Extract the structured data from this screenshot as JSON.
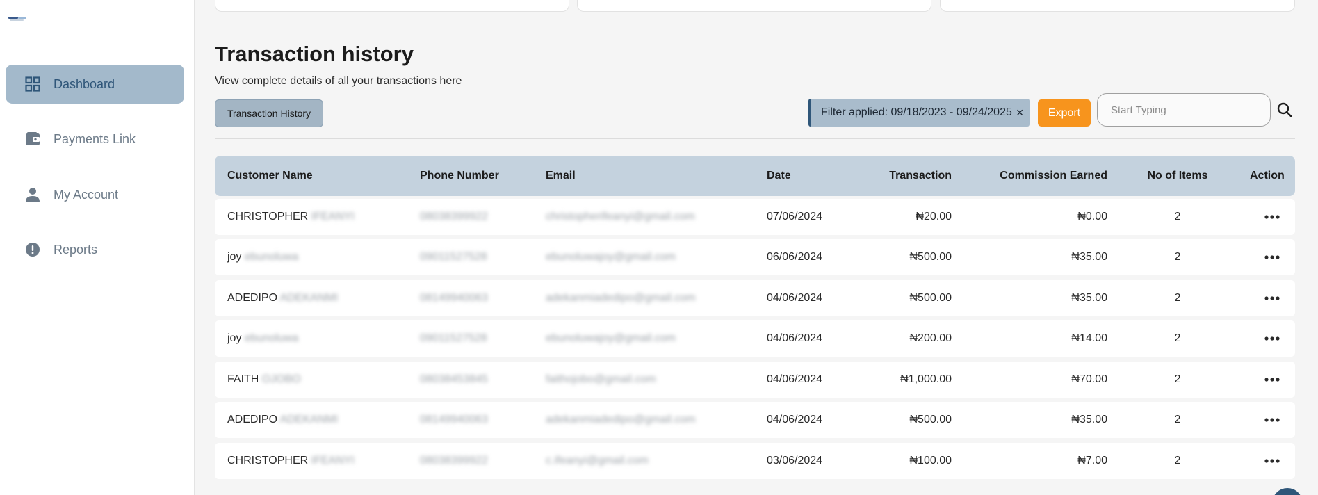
{
  "sidebar": {
    "items": [
      {
        "label": "Dashboard",
        "icon": "grid-icon",
        "active": true
      },
      {
        "label": "Payments Link",
        "icon": "wallet-icon",
        "active": false
      },
      {
        "label": "My Account",
        "icon": "user-icon",
        "active": false
      },
      {
        "label": "Reports",
        "icon": "alert-icon",
        "active": false
      }
    ]
  },
  "header": {
    "title": "Transaction history",
    "subtitle": "View complete details of all your transactions here"
  },
  "toolbar": {
    "tab_label": "Transaction History",
    "filter_label": "Filter applied: 09/18/2023 - 09/24/2025",
    "filter_close": "×",
    "export_label": "Export",
    "search_placeholder": "Start Typing"
  },
  "table": {
    "columns": [
      "Customer Name",
      "Phone Number",
      "Email",
      "Date",
      "Transaction",
      "Commission Earned",
      "No of Items",
      "Action"
    ],
    "rows": [
      {
        "first": "CHRISTOPHER",
        "last": "IFEANYI",
        "phone": "08038399922",
        "email": "christopherifeanyi@gmail.com",
        "date": "07/06/2024",
        "transaction": "₦20.00",
        "commission": "₦0.00",
        "items": "2"
      },
      {
        "first": "joy",
        "last": "ebunoluwa",
        "phone": "09011527528",
        "email": "ebunoluwajoy@gmail.com",
        "date": "06/06/2024",
        "transaction": "₦500.00",
        "commission": "₦35.00",
        "items": "2"
      },
      {
        "first": "ADEDIPO",
        "last": "ADEKANMI",
        "phone": "08149940063",
        "email": "adekanmiadedipo@gmail.com",
        "date": "04/06/2024",
        "transaction": "₦500.00",
        "commission": "₦35.00",
        "items": "2"
      },
      {
        "first": "joy",
        "last": "ebunoluwa",
        "phone": "09011527528",
        "email": "ebunoluwajoy@gmail.com",
        "date": "04/06/2024",
        "transaction": "₦200.00",
        "commission": "₦14.00",
        "items": "2"
      },
      {
        "first": "FAITH",
        "last": "OJOBO",
        "phone": "08038453845",
        "email": "faithojobo@gmail.com",
        "date": "04/06/2024",
        "transaction": "₦1,000.00",
        "commission": "₦70.00",
        "items": "2"
      },
      {
        "first": "ADEDIPO",
        "last": "ADEKANMI",
        "phone": "08149940063",
        "email": "adekanmiadedipo@gmail.com",
        "date": "04/06/2024",
        "transaction": "₦500.00",
        "commission": "₦35.00",
        "items": "2"
      },
      {
        "first": "CHRISTOPHER",
        "last": "IFEANYI",
        "phone": "08038399922",
        "email": "c.ifeanyi@gmail.com",
        "date": "03/06/2024",
        "transaction": "₦100.00",
        "commission": "₦7.00",
        "items": "2"
      }
    ]
  },
  "colors": {
    "accent": "#f7941d",
    "nav_active_bg": "#a3b9cb",
    "table_header_bg": "#c4d2de",
    "brand_blue": "#2f5679"
  }
}
